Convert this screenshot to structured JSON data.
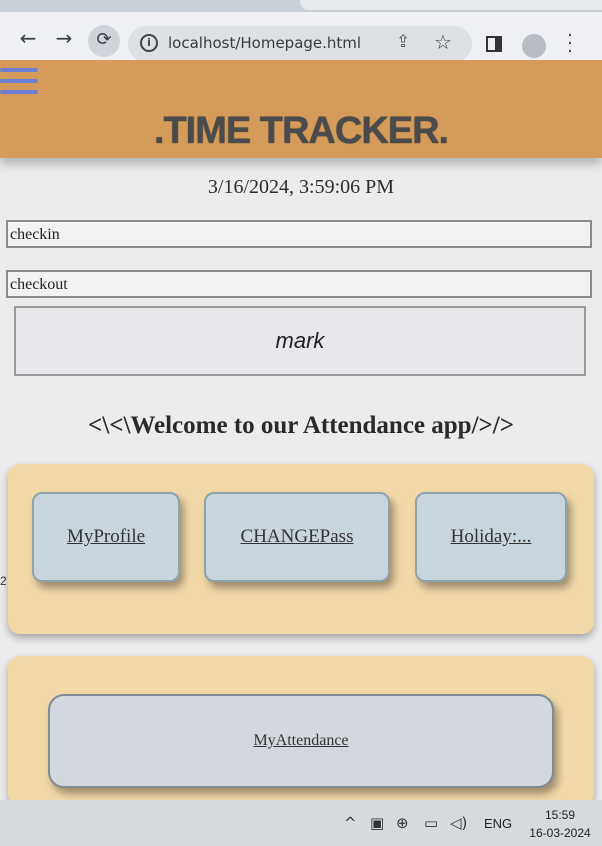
{
  "browser": {
    "url": "localhost/Homepage.html",
    "icons": [
      "back-arrow-icon",
      "forward-arrow-icon",
      "reload-icon",
      "info-icon",
      "share-icon",
      "star-icon",
      "side-panel-icon",
      "profile-icon",
      "menu-icon"
    ]
  },
  "header": {
    "title": ".TIME TRACKER.",
    "color": "#d49b5a"
  },
  "datetime": "3/16/2024, 3:59:06 PM",
  "form": {
    "checkin_value": "checkin",
    "checkout_value": "checkout",
    "mark_label": "mark"
  },
  "welcome": "<\\<\\Welcome to our Attendance app/>/>",
  "nav": [
    {
      "label": "MyProfile"
    },
    {
      "label": "CHANGEPass"
    },
    {
      "label": "Holiday:..."
    }
  ],
  "attendance_label": "MyAttendance",
  "edge_digit": "2",
  "taskbar": {
    "language": "ENG",
    "time": "15:59",
    "date": "16-03-2024"
  }
}
